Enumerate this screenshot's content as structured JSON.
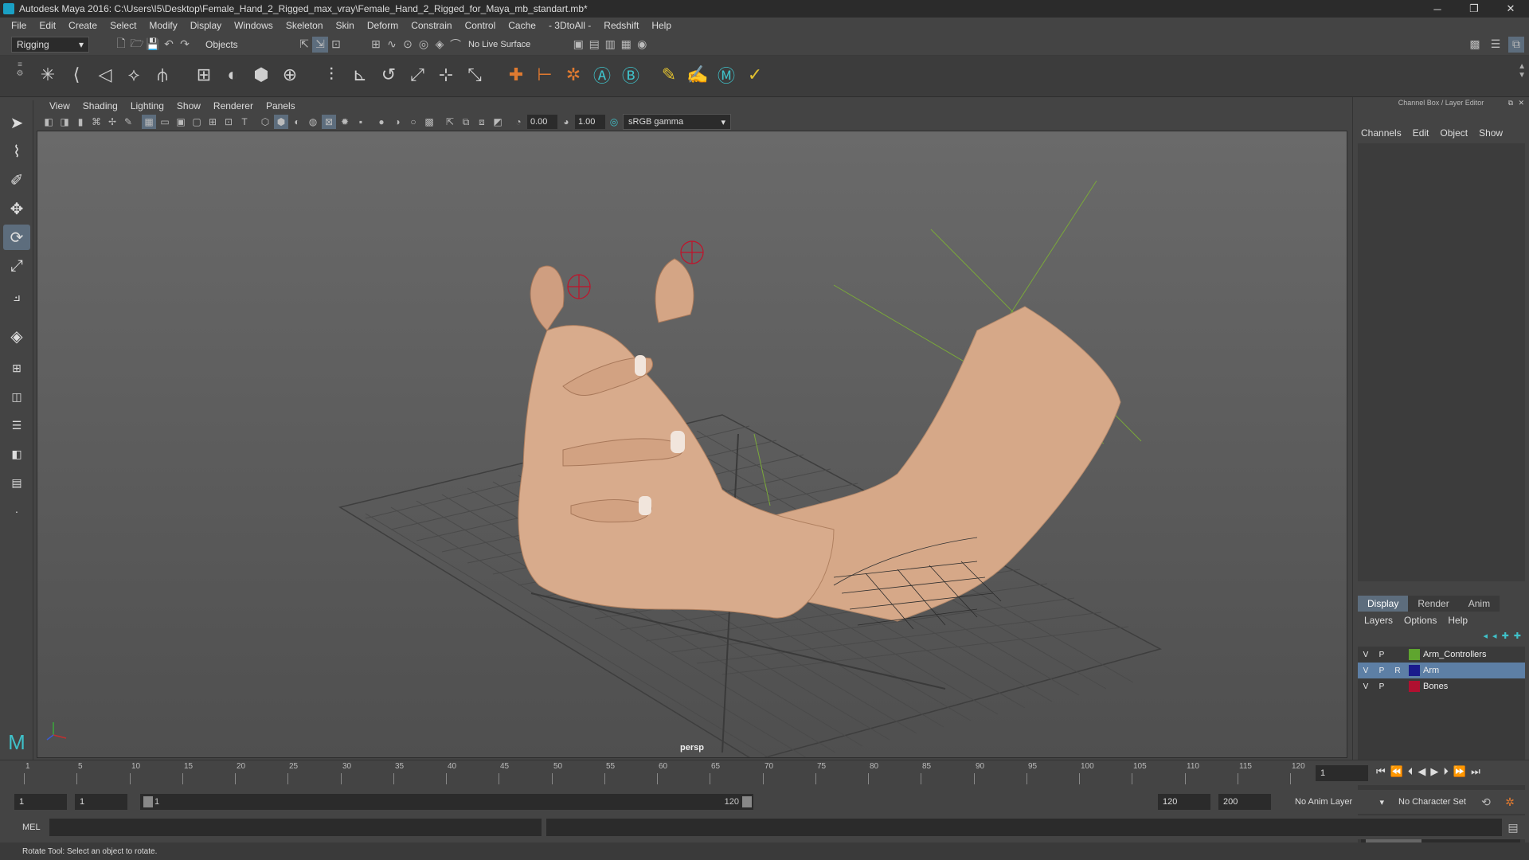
{
  "window": {
    "title": "Autodesk Maya 2016: C:\\Users\\I5\\Desktop\\Female_Hand_2_Rigged_max_vray\\Female_Hand_2_Rigged_for_Maya_mb_standart.mb*"
  },
  "menubar": {
    "items": [
      "File",
      "Edit",
      "Create",
      "Select",
      "Modify",
      "Display",
      "Windows",
      "Skeleton",
      "Skin",
      "Deform",
      "Constrain",
      "Control",
      "Cache",
      "- 3DtoAll -",
      "Redshift",
      "Help"
    ]
  },
  "statusline": {
    "menuset": "Rigging",
    "selection_mode": "Objects",
    "live_surface": "No Live Surface"
  },
  "panel": {
    "menu": [
      "View",
      "Shading",
      "Lighting",
      "Show",
      "Renderer",
      "Panels"
    ],
    "exposure": "0.00",
    "gamma": "1.00",
    "colorspace": "sRGB gamma",
    "camera_label": "persp"
  },
  "channelbox": {
    "header": "Channel Box / Layer Editor",
    "menu": [
      "Channels",
      "Edit",
      "Object",
      "Show"
    ]
  },
  "layereditor": {
    "tabs": [
      "Display",
      "Render",
      "Anim"
    ],
    "menu": [
      "Layers",
      "Options",
      "Help"
    ],
    "layers": [
      {
        "v": "V",
        "p": "P",
        "r": "",
        "name": "Arm_Controllers",
        "color": "#5fa52f"
      },
      {
        "v": "V",
        "p": "P",
        "r": "R",
        "name": "Arm",
        "color": "#1a1a8c"
      },
      {
        "v": "V",
        "p": "P",
        "r": "",
        "name": "Bones",
        "color": "#b01030"
      }
    ]
  },
  "timeslider": {
    "ticks": [
      "1",
      "5",
      "10",
      "15",
      "20",
      "25",
      "30",
      "35",
      "40",
      "45",
      "50",
      "55",
      "60",
      "65",
      "70",
      "75",
      "80",
      "85",
      "90",
      "95",
      "100",
      "105",
      "110",
      "115",
      "120"
    ],
    "current_frame": "1"
  },
  "rangeslider": {
    "start": "1",
    "playback_start": "1",
    "range_start": "1",
    "range_end": "120",
    "playback_end": "120",
    "end": "200",
    "anim_layer": "No Anim Layer",
    "character_set": "No Character Set"
  },
  "commandline": {
    "label": "MEL"
  },
  "helpline": {
    "text": "Rotate Tool: Select an object to rotate."
  },
  "colors": {
    "accent": "#5d6d7d",
    "skin": "#d8ab8c"
  },
  "icons": [
    "select-tool-icon",
    "lasso-tool-icon",
    "paint-select-icon",
    "move-tool-icon",
    "rotate-tool-icon",
    "scale-tool-icon",
    "last-tool-icon"
  ]
}
